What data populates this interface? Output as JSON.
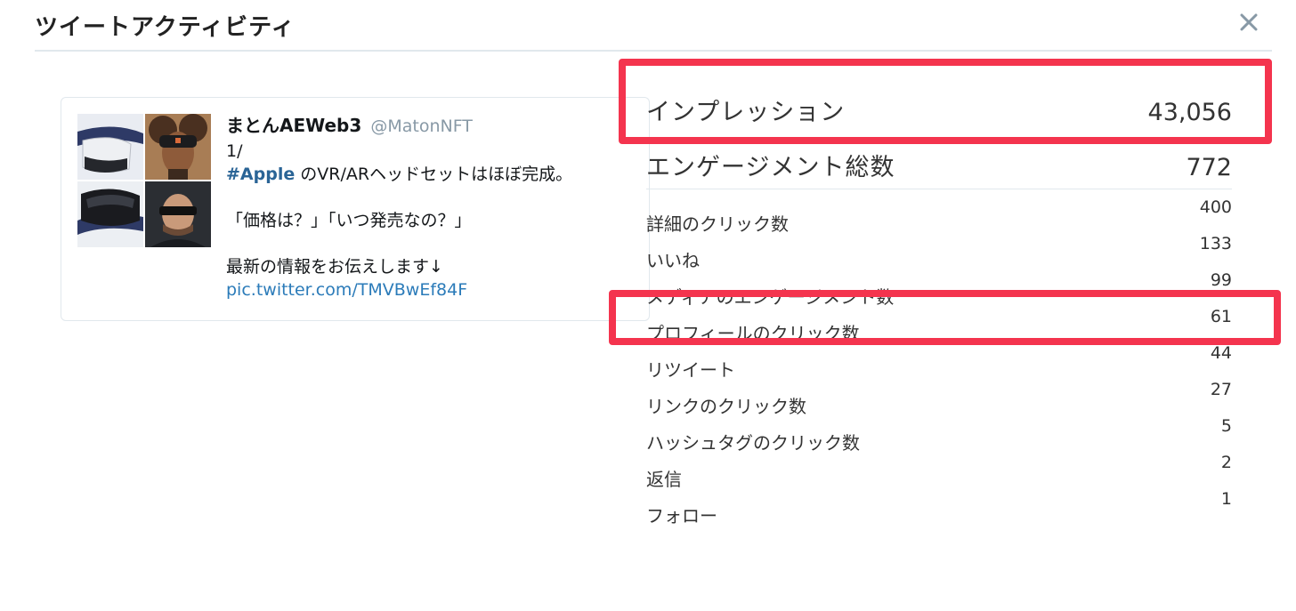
{
  "modal": {
    "title": "ツイートアクティビティ",
    "close_icon": "close-icon"
  },
  "tweet": {
    "author_name": "まとんAEWeb3",
    "author_handle": "@MatonNFT",
    "line1": "1/",
    "hashtag": "#Apple",
    "line2_rest": " のVR/ARヘッドセットはほぼ完成。",
    "line3": "「価格は？」「いつ発売なの？」",
    "line4": "最新の情報をお伝えします↓",
    "link": "pic.twitter.com/TMVBwEf84F"
  },
  "metrics": {
    "impressions": {
      "label": "インプレッション",
      "value": "43,056"
    },
    "engagements": {
      "label": "エンゲージメント総数",
      "value": "772"
    },
    "rows": [
      {
        "label": "詳細のクリック数",
        "value": "400"
      },
      {
        "label": "いいね",
        "value": "133"
      },
      {
        "label": "メディアのエンゲージメント数",
        "value": "99"
      },
      {
        "label": "プロフィールのクリック数",
        "value": "61"
      },
      {
        "label": "リツイート",
        "value": "44"
      },
      {
        "label": "リンクのクリック数",
        "value": "27"
      },
      {
        "label": "ハッシュタグのクリック数",
        "value": "5"
      },
      {
        "label": "返信",
        "value": "2"
      },
      {
        "label": "フォロー",
        "value": "1"
      }
    ]
  },
  "colors": {
    "highlight": "#f4344e",
    "link": "#2b7bb9",
    "hashtag": "#2a6496"
  }
}
